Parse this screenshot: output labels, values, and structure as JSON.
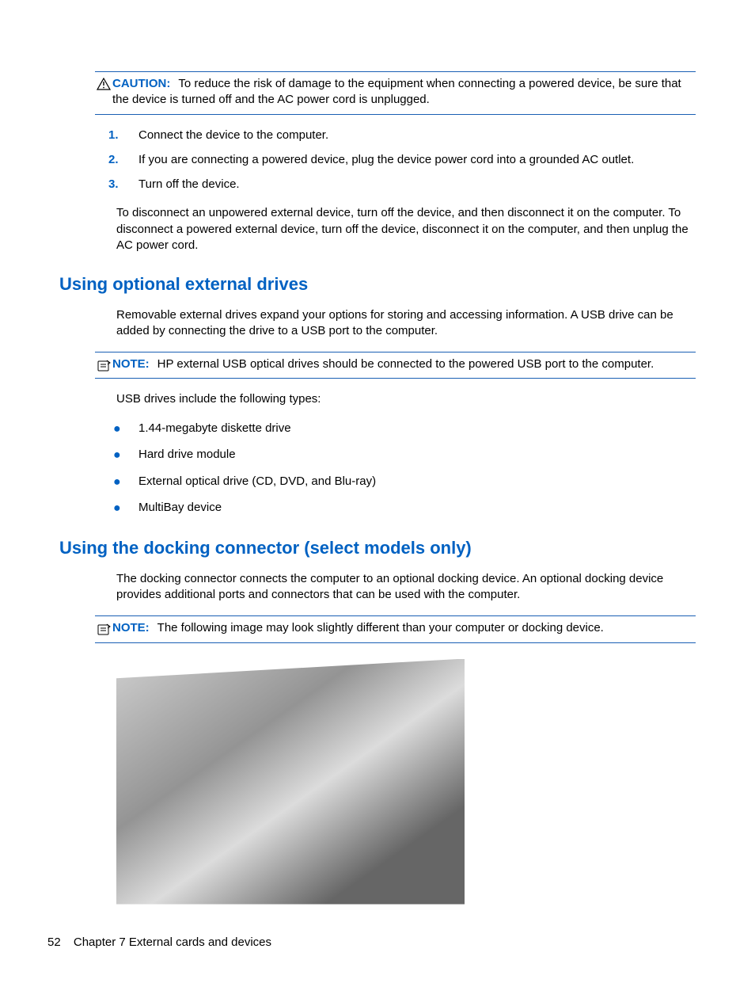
{
  "caution": {
    "label": "CAUTION:",
    "text": "To reduce the risk of damage to the equipment when connecting a powered device, be sure that the device is turned off and the AC power cord is unplugged."
  },
  "steps": [
    "Connect the device to the computer.",
    "If you are connecting a powered device, plug the device power cord into a grounded AC outlet.",
    "Turn off the device."
  ],
  "disconnect_para": "To disconnect an unpowered external device, turn off the device, and then disconnect it on the computer. To disconnect a powered external device, turn off the device, disconnect it on the computer, and then unplug the AC power cord.",
  "section1": {
    "heading": "Using optional external drives",
    "para": "Removable external drives expand your options for storing and accessing information. A USB drive can be added by connecting the drive to a USB port to the computer.",
    "note_label": "NOTE:",
    "note_text": "HP external USB optical drives should be connected to the powered USB port to the computer.",
    "intro_list": "USB drives include the following types:",
    "items": [
      "1.44-megabyte diskette drive",
      "Hard drive module",
      "External optical drive (CD, DVD, and Blu-ray)",
      "MultiBay device"
    ]
  },
  "section2": {
    "heading": "Using the docking connector (select models only)",
    "para": "The docking connector connects the computer to an optional docking device. An optional docking device provides additional ports and connectors that can be used with the computer.",
    "note_label": "NOTE:",
    "note_text": "The following image may look slightly different than your computer or docking device."
  },
  "footer": {
    "page": "52",
    "chapter": "Chapter 7   External cards and devices"
  }
}
